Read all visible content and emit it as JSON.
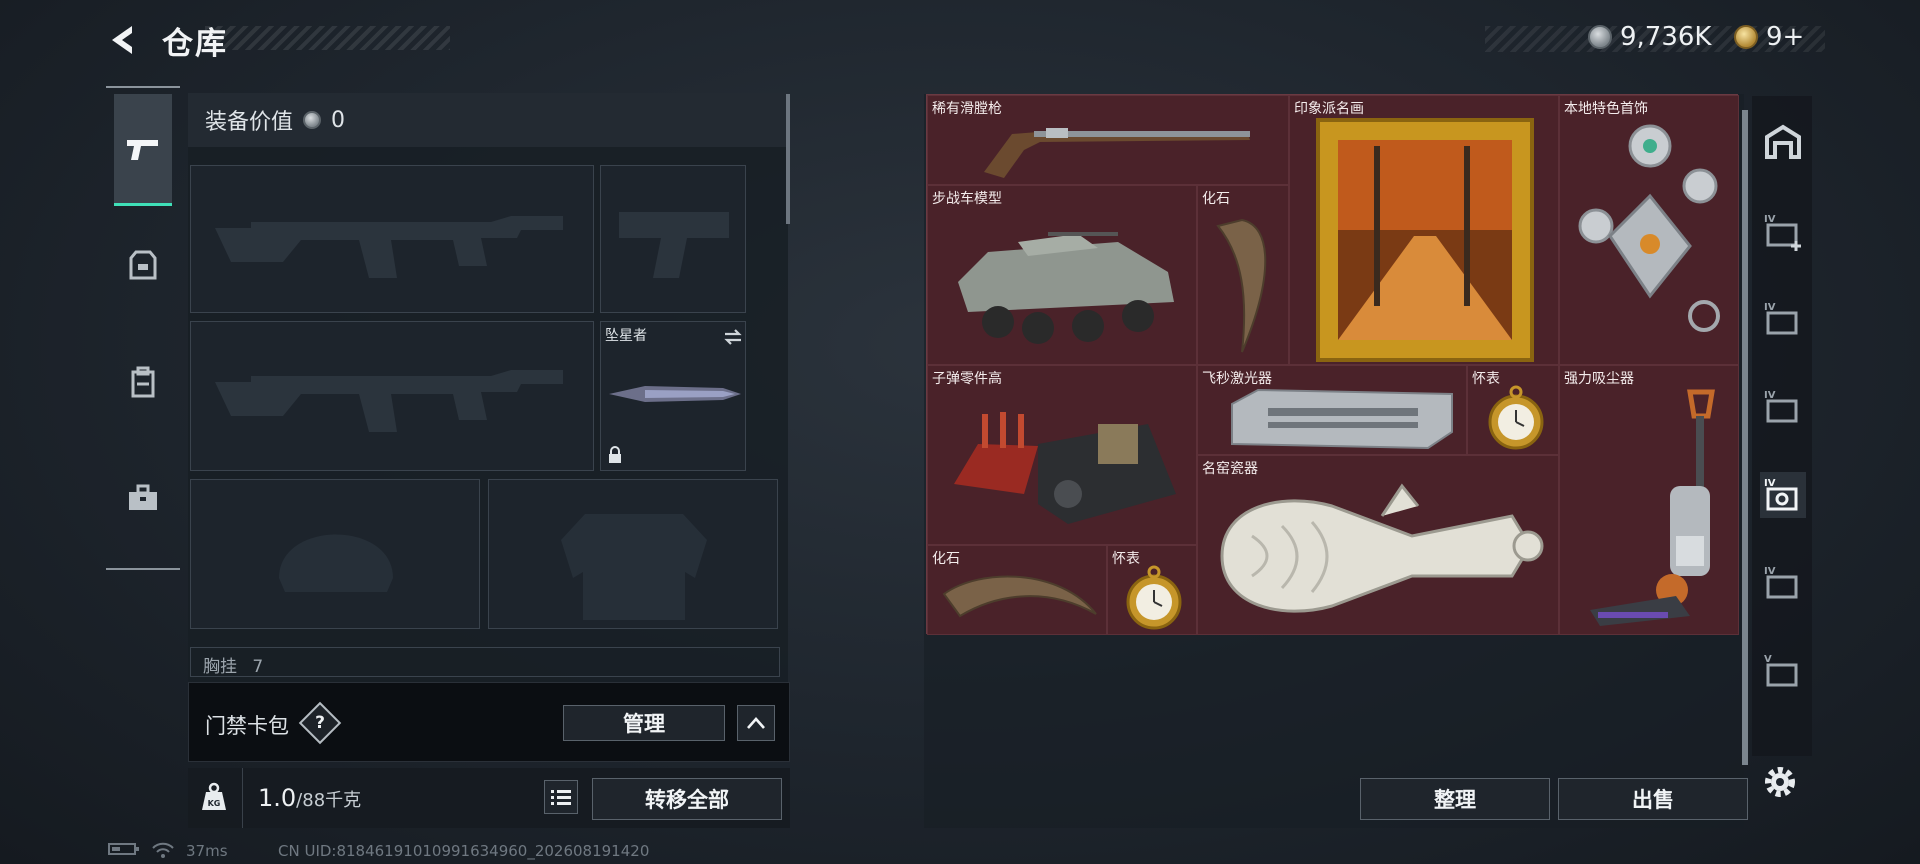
{
  "header": {
    "title": "仓库",
    "currency_silver": "9,736K",
    "currency_gold": "9+"
  },
  "loadout": {
    "value_label": "装备价值",
    "value": "0",
    "slots": {
      "melee_name": "坠星者"
    },
    "chest_label": "胸挂",
    "chest_value": "7"
  },
  "card_bag": {
    "label": "门禁卡包",
    "help": "?",
    "manage_label": "管理"
  },
  "weight": {
    "current": "1.0",
    "max": "/88千克",
    "transfer_all_label": "转移全部"
  },
  "status": {
    "ping": "37ms",
    "uid": "CN UID:81846191010991634960_202608191420"
  },
  "inventory": {
    "items": [
      {
        "name": "稀有滑膛枪"
      },
      {
        "name": "印象派名画"
      },
      {
        "name": "本地特色首饰"
      },
      {
        "name": "步战车模型"
      },
      {
        "name": "化石"
      },
      {
        "name": "子弹零件高"
      },
      {
        "name": "飞秒激光器"
      },
      {
        "name": "怀表"
      },
      {
        "name": "强力吸尘器"
      },
      {
        "name": "名窑瓷器"
      },
      {
        "name": "化石"
      },
      {
        "name": "怀表"
      }
    ],
    "sort_label": "整理",
    "sell_label": "出售"
  },
  "side_tabs": [
    "IV",
    "IV",
    "IV",
    "IV",
    "IV",
    "V"
  ],
  "colors": {
    "accent": "#3fe0b8",
    "slot_bg": "#4a2229"
  }
}
